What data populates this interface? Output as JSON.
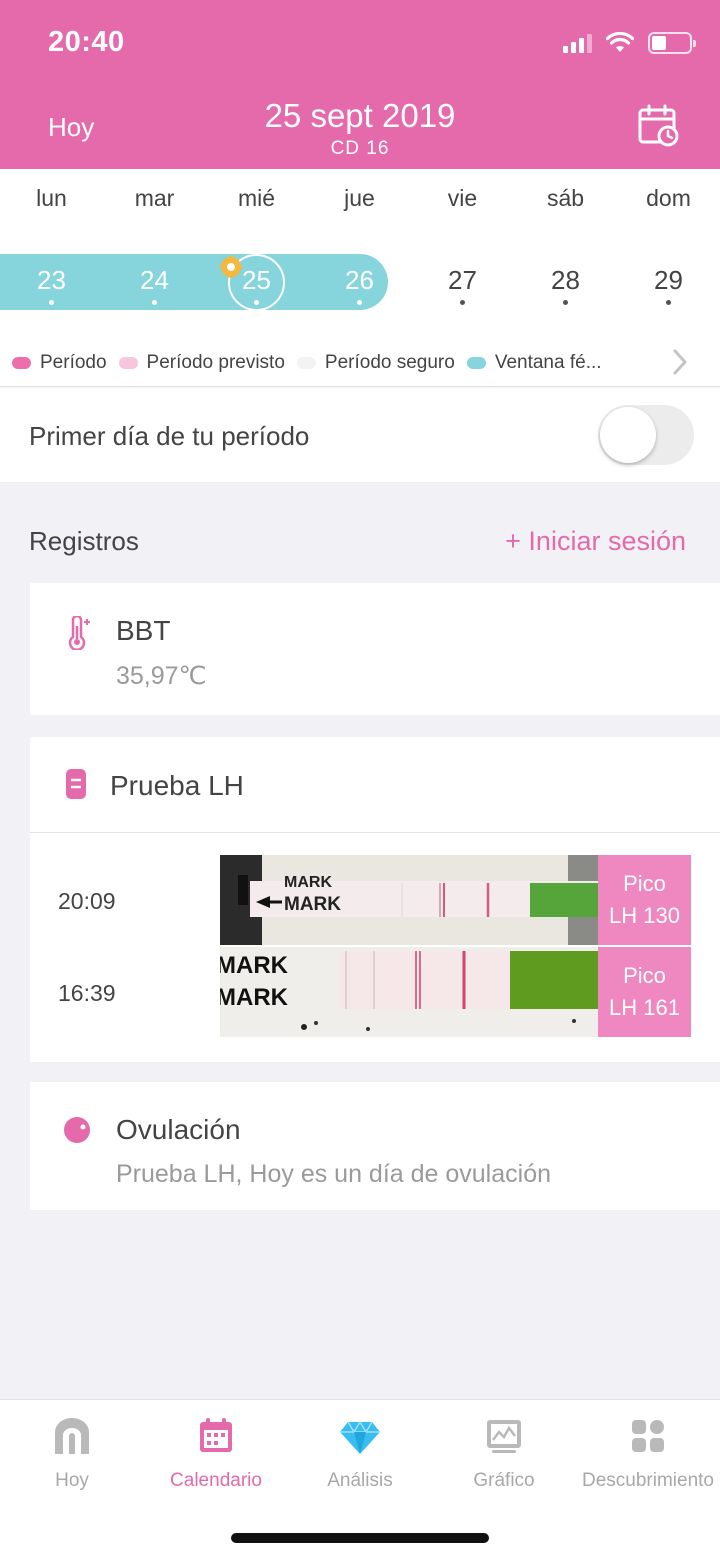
{
  "status": {
    "time": "20:40"
  },
  "header": {
    "today_label": "Hoy",
    "date": "25 sept 2019",
    "cycle_day": "CD 16"
  },
  "week": {
    "weekdays": [
      "lun",
      "mar",
      "mié",
      "jue",
      "vie",
      "sáb",
      "dom"
    ],
    "days": [
      "23",
      "24",
      "25",
      "26",
      "27",
      "28",
      "29"
    ],
    "fertile_days": [
      "23",
      "24",
      "25",
      "26"
    ],
    "selected_day": "25"
  },
  "legend": {
    "items": [
      {
        "label": "Período",
        "color": "#ec6fab"
      },
      {
        "label": "Período previsto",
        "color": "#f6c6df"
      },
      {
        "label": "Período seguro",
        "color": "#f3f3f3"
      },
      {
        "label": "Ventana fé...",
        "color": "#86d4dc"
      }
    ]
  },
  "first_day": {
    "label": "Primer día de tu período",
    "enabled": false
  },
  "records": {
    "title": "Registros",
    "login": "+ Iniciar sesión",
    "bbt": {
      "title": "BBT",
      "value": "35,97℃"
    },
    "lh": {
      "title": "Prueba LH",
      "entries": [
        {
          "time": "20:09",
          "badge1": "Pico",
          "badge2": "LH 130"
        },
        {
          "time": "16:39",
          "badge1": "Pico",
          "badge2": "LH 161"
        }
      ]
    },
    "ovulation": {
      "title": "Ovulación",
      "description": "Prueba LH, Hoy es un día de ovulación"
    }
  },
  "tabs": [
    {
      "label": "Hoy",
      "icon": "home-arch-icon",
      "active": false
    },
    {
      "label": "Calendario",
      "icon": "calendar-icon",
      "active": true
    },
    {
      "label": "Análisis",
      "icon": "diamond-icon",
      "active": false
    },
    {
      "label": "Gráfico",
      "icon": "chart-icon",
      "active": false
    },
    {
      "label": "Descubrimiento",
      "icon": "discover-icon",
      "active": false
    }
  ],
  "colors": {
    "brand_pink": "#e46aab",
    "fertile_teal": "#86d4dc",
    "badge_pink": "#ef88c1"
  }
}
